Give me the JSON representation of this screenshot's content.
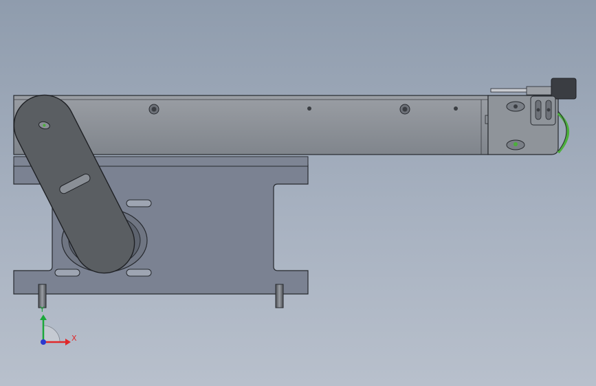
{
  "viewport": {
    "background_top": "#8f9cad",
    "background_bottom": "#b8c0cc"
  },
  "triad": {
    "x_label": "X",
    "y_label": "Y",
    "x_color": "#e0282a",
    "y_color": "#1aa83a",
    "z_color": "#2a3ad0"
  },
  "model": {
    "part_color": "#7d8594",
    "upper_bar_color": "#8a8f96",
    "arm_color": "#5a5e62",
    "edge_color": "#26292e",
    "highlight_color": "#4caf3c"
  }
}
